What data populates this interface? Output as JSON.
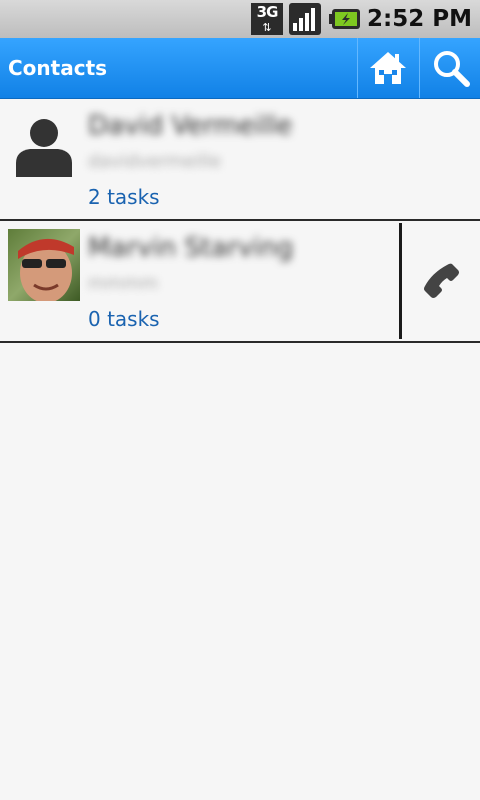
{
  "status_bar": {
    "network": "3G",
    "time": "2:52 PM"
  },
  "action_bar": {
    "title": "Contacts",
    "home_icon": "home-icon",
    "search_icon": "search-icon",
    "color": "#1e8ff4"
  },
  "contacts": [
    {
      "name": "David Vermeille",
      "subtitle": "davidvermeille",
      "tasks": "2 tasks",
      "avatar": "default-person-icon"
    },
    {
      "name": "Marvin Starving",
      "subtitle": "mmmm",
      "tasks": "0 tasks",
      "avatar": "contact-photo",
      "call_icon": "phone-icon"
    }
  ],
  "colors": {
    "tasks_link": "#1a63b0",
    "background": "#f6f6f6"
  }
}
